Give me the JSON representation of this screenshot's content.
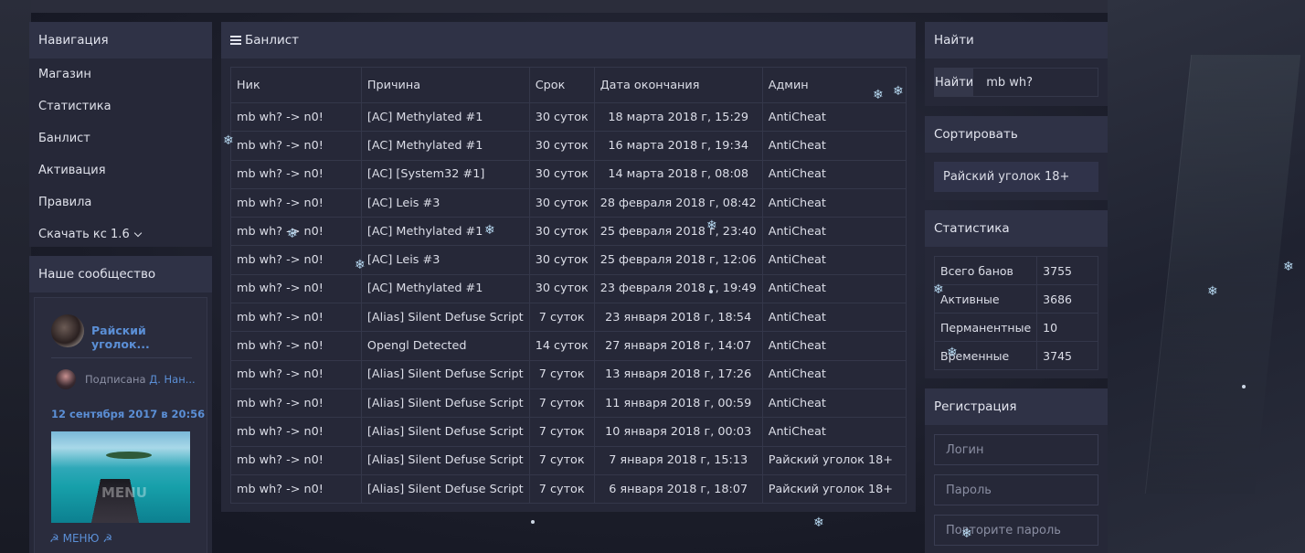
{
  "nav": {
    "title": "Навигация",
    "items": [
      "Магазин",
      "Статистика",
      "Банлист",
      "Активация",
      "Правила"
    ],
    "download_label": "Скачать кс 1.6"
  },
  "community": {
    "title": "Наше сообщество",
    "group_name": "Райский уголок...",
    "signed_prefix": "Подписана",
    "signed_name": "Д. Нан...",
    "post_date": "12 сентября 2017 в 20:56",
    "image_text": "MENU",
    "menu_link": "МЕНЮ"
  },
  "banlist": {
    "title": "Банлист",
    "columns": [
      "Ник",
      "Причина",
      "Срок",
      "Дата окончания",
      "Админ"
    ],
    "rows": [
      [
        "mb wh? -> n0!",
        "[AC] Methylated #1",
        "30 суток",
        "18 марта 2018 г, 15:29",
        "AntiCheat"
      ],
      [
        "mb wh? -> n0!",
        "[AC] Methylated #1",
        "30 суток",
        "16 марта 2018 г, 19:34",
        "AntiCheat"
      ],
      [
        "mb wh? -> n0!",
        "[AC] [System32 #1]",
        "30 суток",
        "14 марта 2018 г, 08:08",
        "AntiCheat"
      ],
      [
        "mb wh? -> n0!",
        "[AC] Leis #3",
        "30 суток",
        "28 февраля 2018 г, 08:42",
        "AntiCheat"
      ],
      [
        "mb wh? -> n0!",
        "[AC] Methylated #1",
        "30 суток",
        "25 февраля 2018 г, 23:40",
        "AntiCheat"
      ],
      [
        "mb wh? -> n0!",
        "[AC] Leis #3",
        "30 суток",
        "25 февраля 2018 г, 12:06",
        "AntiCheat"
      ],
      [
        "mb wh? -> n0!",
        "[AC] Methylated #1",
        "30 суток",
        "23 февраля 2018 г, 19:49",
        "AntiCheat"
      ],
      [
        "mb wh? -> n0!",
        "[Alias] Silent Defuse Script",
        "7 суток",
        "23 января 2018 г, 18:54",
        "AntiCheat"
      ],
      [
        "mb wh? -> n0!",
        "Opengl Detected",
        "14 суток",
        "27 января 2018 г, 14:07",
        "AntiCheat"
      ],
      [
        "mb wh? -> n0!",
        "[Alias] Silent Defuse Script",
        "7 суток",
        "13 января 2018 г, 17:26",
        "AntiCheat"
      ],
      [
        "mb wh? -> n0!",
        "[Alias] Silent Defuse Script",
        "7 суток",
        "11 января 2018 г, 00:59",
        "AntiCheat"
      ],
      [
        "mb wh? -> n0!",
        "[Alias] Silent Defuse Script",
        "7 суток",
        "10 января 2018 г, 00:03",
        "AntiCheat"
      ],
      [
        "mb wh? -> n0!",
        "[Alias] Silent Defuse Script",
        "7 суток",
        "7 января 2018 г, 15:13",
        "Райский уголок 18+"
      ],
      [
        "mb wh? -> n0!",
        "[Alias] Silent Defuse Script",
        "7 суток",
        "6 января 2018 г, 18:07",
        "Райский уголок 18+"
      ]
    ]
  },
  "find": {
    "title": "Найти",
    "button_label": "Найти",
    "query": "mb wh?"
  },
  "sort": {
    "title": "Сортировать",
    "selected": "Райский уголок 18+"
  },
  "stats": {
    "title": "Статистика",
    "rows": [
      [
        "Всего банов",
        "3755"
      ],
      [
        "Активные",
        "3686"
      ],
      [
        "Перманентные",
        "10"
      ],
      [
        "Временные",
        "3745"
      ]
    ]
  },
  "register": {
    "title": "Регистрация",
    "login_placeholder": "Логин",
    "password_placeholder": "Пароль",
    "repeat_placeholder": "Повторите пароль"
  },
  "colors": {
    "panel": "#262838",
    "panel_header": "#2f3246",
    "link": "#5b8fd6"
  }
}
